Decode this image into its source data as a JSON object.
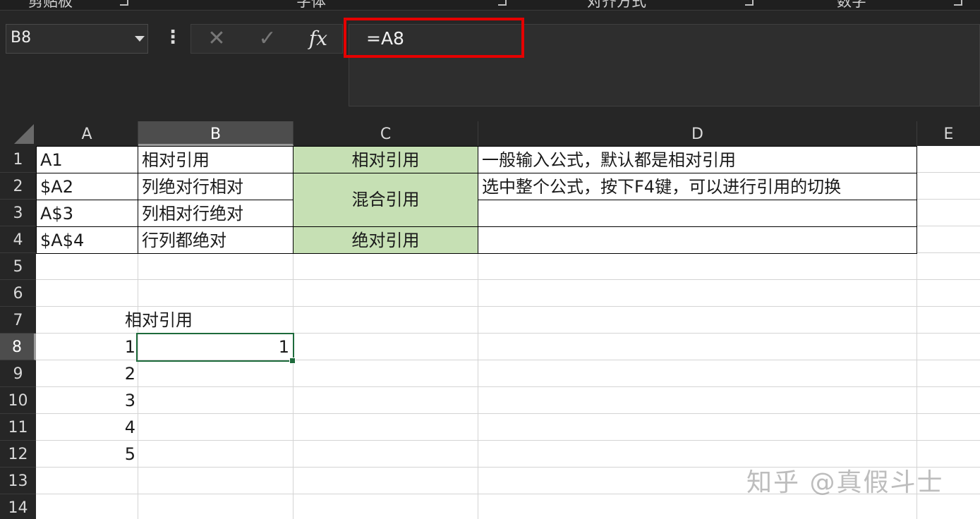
{
  "ribbon": {
    "groups": [
      {
        "label": "剪贴板"
      },
      {
        "label": "字体"
      },
      {
        "label": "对齐方式"
      },
      {
        "label": "数字"
      }
    ]
  },
  "formula_bar": {
    "name_box": "B8",
    "options_glyph": "⋮",
    "cancel_glyph": "✕",
    "enter_glyph": "✓",
    "fx_label": "fx",
    "formula": "=A8"
  },
  "sheet": {
    "columns": [
      "A",
      "B",
      "C",
      "D",
      "E"
    ],
    "active_column": "B",
    "rows": [
      "1",
      "2",
      "3",
      "4",
      "5",
      "6",
      "7",
      "8",
      "9",
      "10",
      "11",
      "12",
      "13",
      "14"
    ],
    "active_row": "8",
    "table": {
      "a1": "A1",
      "a2": "$A2",
      "a3": "A$3",
      "a4": "$A$4",
      "b1": "相对引用",
      "b2": "列绝对行相对",
      "b3": "列相对行绝对",
      "b4": "行列都绝对",
      "c1": "相对引用",
      "c23": "混合引用",
      "c4": "绝对引用",
      "d1": "一般输入公式，默认都是相对引用",
      "d2": "选中整个公式，按下F4键，可以进行引用的切换",
      "d3": "",
      "d4": ""
    },
    "lower": {
      "a7": "相对引用",
      "a8": "1",
      "a9": "2",
      "a10": "3",
      "a11": "4",
      "a12": "5",
      "b8": "1"
    }
  },
  "colors": {
    "highlight": "#e50000",
    "green_fill": "#c6e0b4",
    "active_border": "#1e6b3c"
  },
  "watermark": "知乎 @真假斗士"
}
